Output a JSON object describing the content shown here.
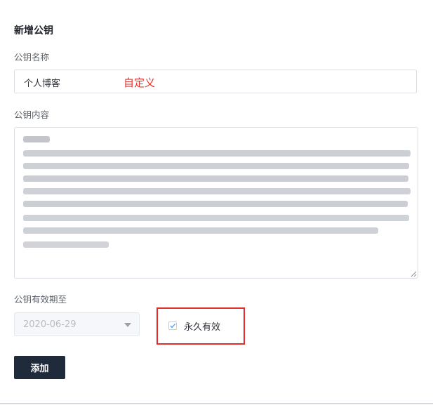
{
  "form": {
    "title": "新增公钥",
    "name_label": "公钥名称",
    "name_value": "个人博客",
    "name_annotation": "自定义",
    "content_label": "公钥内容",
    "content_value_redacted": true,
    "expiry_label": "公钥有效期至",
    "expiry_date": "2020-06-29",
    "permanent_label": "永久有效",
    "permanent_checked": true,
    "submit_label": "添加"
  },
  "colors": {
    "primary_button": "#1f2a3a",
    "annotation_red": "#e0322c",
    "checkbox_accent": "#409eff"
  }
}
